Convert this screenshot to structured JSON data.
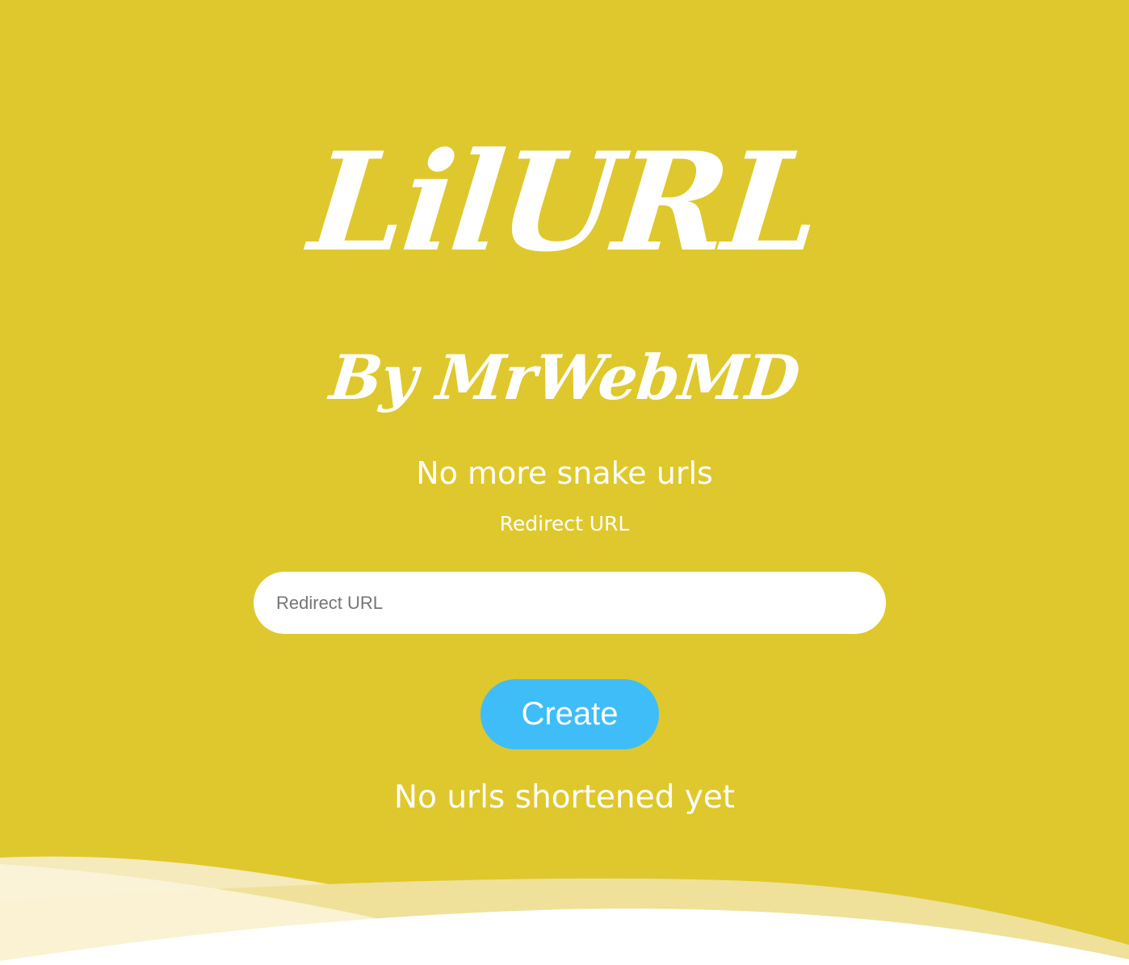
{
  "header": {
    "logo_text": "LilURL",
    "byline": "By MrWebMD",
    "tagline": "No more snake urls"
  },
  "form": {
    "field_label": "Redirect URL",
    "input_placeholder": "Redirect URL",
    "input_value": "",
    "submit_label": "Create"
  },
  "results": {
    "status_text": "No urls shortened yet"
  },
  "colors": {
    "background": "#dfc82d",
    "button": "#3fbdf8",
    "text": "#ffffff"
  }
}
